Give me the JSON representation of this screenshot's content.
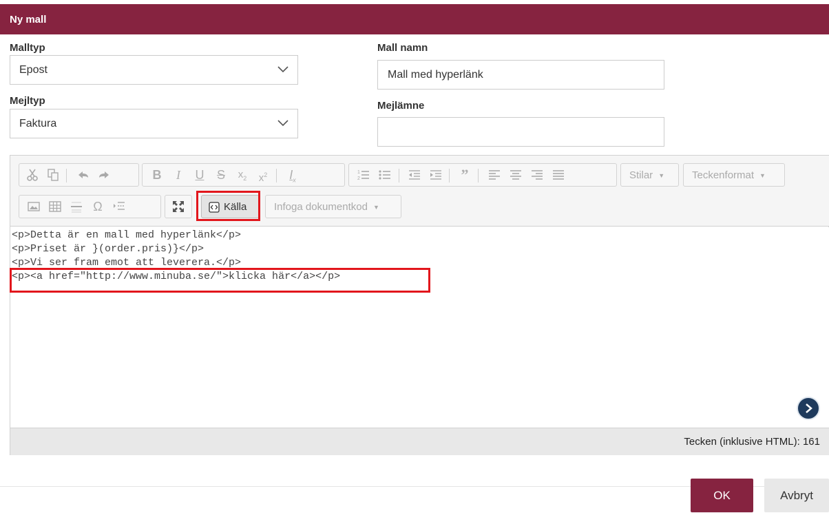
{
  "dialog": {
    "title": "Ny mall"
  },
  "form": {
    "malltyp_label": "Malltyp",
    "malltyp_value": "Epost",
    "mejltyp_label": "Mejltyp",
    "mejltyp_value": "Faktura",
    "mallnamn_label": "Mall namn",
    "mallnamn_value": "Mall med hyperlänk",
    "mejlamne_label": "Mejlämne",
    "mejlamne_value": ""
  },
  "toolbar": {
    "styles_label": "Stilar",
    "format_label": "Teckenformat",
    "source_label": "Källa",
    "insert_code_label": "Infoga dokumentkod"
  },
  "editor": {
    "lines": [
      "<p>Detta är en mall med hyperlänk</p>",
      "<p>Priset är }(order.pris)}</p>",
      "<p>Vi ser fram emot att leverera.</p>",
      "<p><a href=\"http://www.minuba.se/\">klicka här</a></p>"
    ],
    "char_count": "Tecken (inklusive HTML): 161"
  },
  "footer": {
    "ok_label": "OK",
    "cancel_label": "Avbryt"
  },
  "colors": {
    "brand": "#862340",
    "highlight": "#e2161c"
  }
}
